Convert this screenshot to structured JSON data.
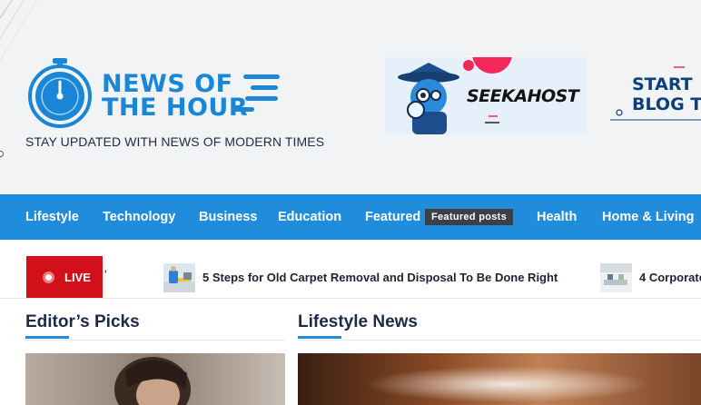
{
  "site": {
    "logo_line1": "NEWS OF",
    "logo_line2": "THE HOUR",
    "tagline": "STAY UPDATED WITH NEWS OF MODERN TIMES",
    "brand_color": "#1a86d8"
  },
  "ads": {
    "seekahost": "SEEKAHOST",
    "start_blog_line1": "START",
    "start_blog_line2": "BLOG T"
  },
  "nav": {
    "items": [
      {
        "label": "Lifestyle"
      },
      {
        "label": "Technology"
      },
      {
        "label": "Business"
      },
      {
        "label": "Education"
      },
      {
        "label": "Featured"
      },
      {
        "label": "Health"
      },
      {
        "label": "Home & Living"
      }
    ],
    "featured_badge": "Featured posts",
    "bar_color": "#1f8ddb"
  },
  "ticker": {
    "live_label": "LIVE",
    "live_color": "#d1101a",
    "items": [
      {
        "title": "5 Steps for Old Carpet Removal and Disposal To Be Done Right"
      },
      {
        "title": "4 Corporate"
      }
    ]
  },
  "sections": {
    "editors_picks": "Editor’s Picks",
    "lifestyle_news": "Lifestyle News"
  }
}
